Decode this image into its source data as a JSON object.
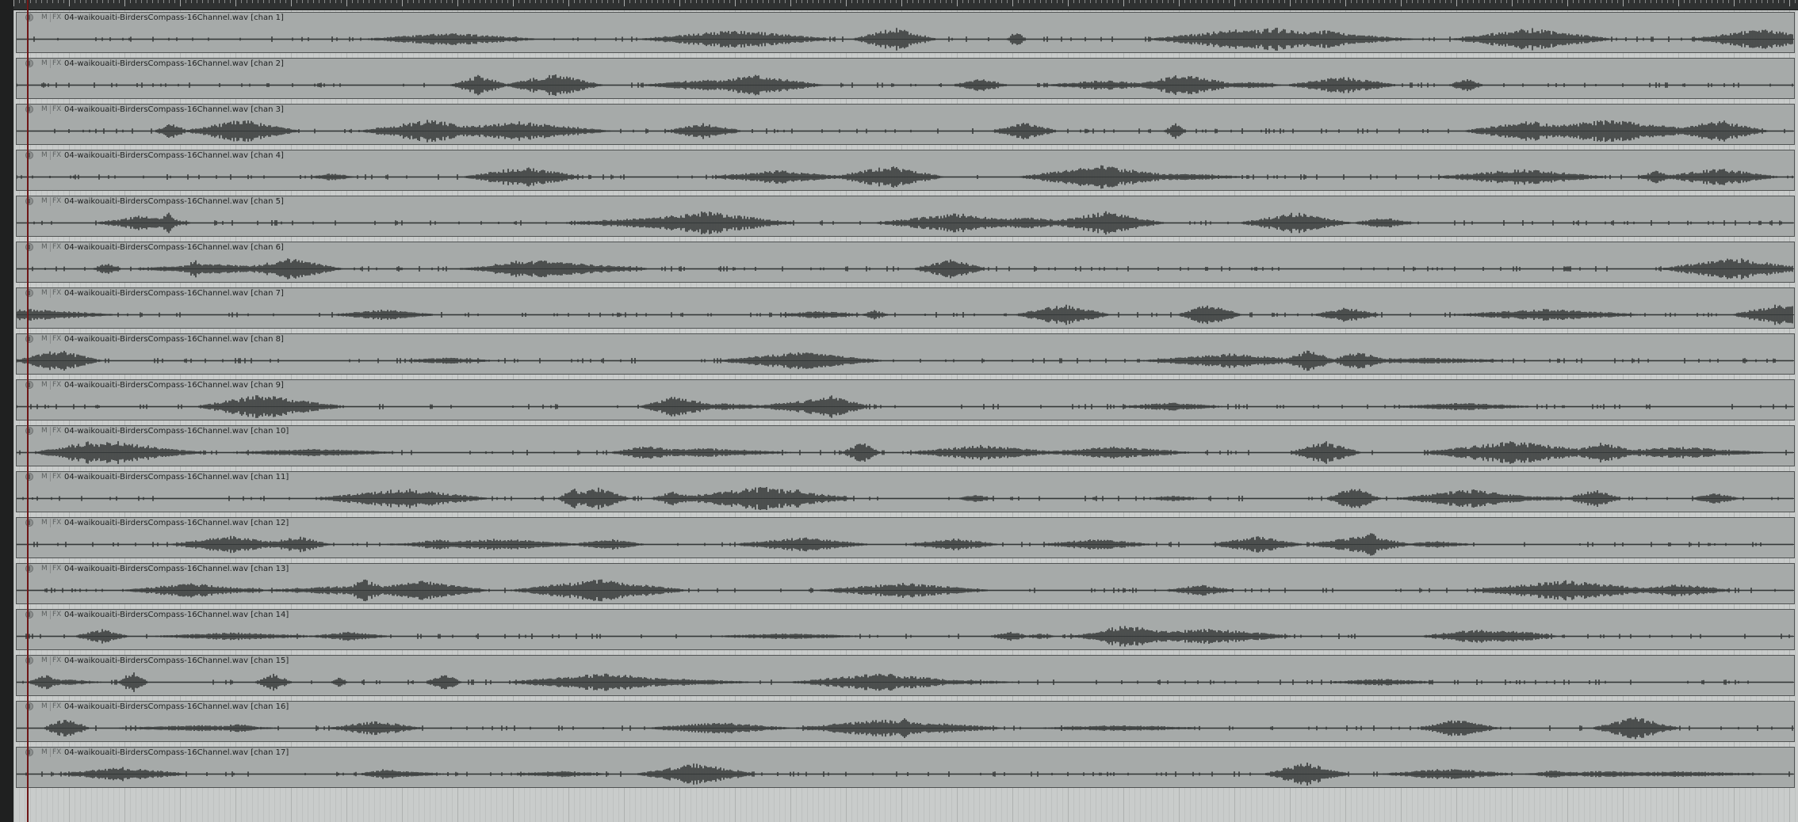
{
  "colors": {
    "background": "#c9cccb",
    "item_fill": "#a6aaa9",
    "waveform": "#353838",
    "ruler": "#2f3131",
    "left_bar": "#1f2020",
    "play_cursor": "#7a1a1a"
  },
  "item_buttons": {
    "mute": "M",
    "fx": "FX"
  },
  "icons": {
    "item_icon": "item-take-icon"
  },
  "tracks": [
    {
      "name": "04-waikouaiti-BirdersCompass-16Channel.wav [chan 1]"
    },
    {
      "name": "04-waikouaiti-BirdersCompass-16Channel.wav [chan 2]"
    },
    {
      "name": "04-waikouaiti-BirdersCompass-16Channel.wav [chan 3]"
    },
    {
      "name": "04-waikouaiti-BirdersCompass-16Channel.wav [chan 4]"
    },
    {
      "name": "04-waikouaiti-BirdersCompass-16Channel.wav [chan 5]"
    },
    {
      "name": "04-waikouaiti-BirdersCompass-16Channel.wav [chan 6]"
    },
    {
      "name": "04-waikouaiti-BirdersCompass-16Channel.wav [chan 7]"
    },
    {
      "name": "04-waikouaiti-BirdersCompass-16Channel.wav [chan 8]"
    },
    {
      "name": "04-waikouaiti-BirdersCompass-16Channel.wav [chan 9]"
    },
    {
      "name": "04-waikouaiti-BirdersCompass-16Channel.wav [chan 10]"
    },
    {
      "name": "04-waikouaiti-BirdersCompass-16Channel.wav [chan 11]"
    },
    {
      "name": "04-waikouaiti-BirdersCompass-16Channel.wav [chan 12]"
    },
    {
      "name": "04-waikouaiti-BirdersCompass-16Channel.wav [chan 13]"
    },
    {
      "name": "04-waikouaiti-BirdersCompass-16Channel.wav [chan 14]"
    },
    {
      "name": "04-waikouaiti-BirdersCompass-16Channel.wav [chan 15]"
    },
    {
      "name": "04-waikouaiti-BirdersCompass-16Channel.wav [chan 16]"
    },
    {
      "name": "04-waikouaiti-BirdersCompass-16Channel.wav [chan 17]"
    }
  ]
}
